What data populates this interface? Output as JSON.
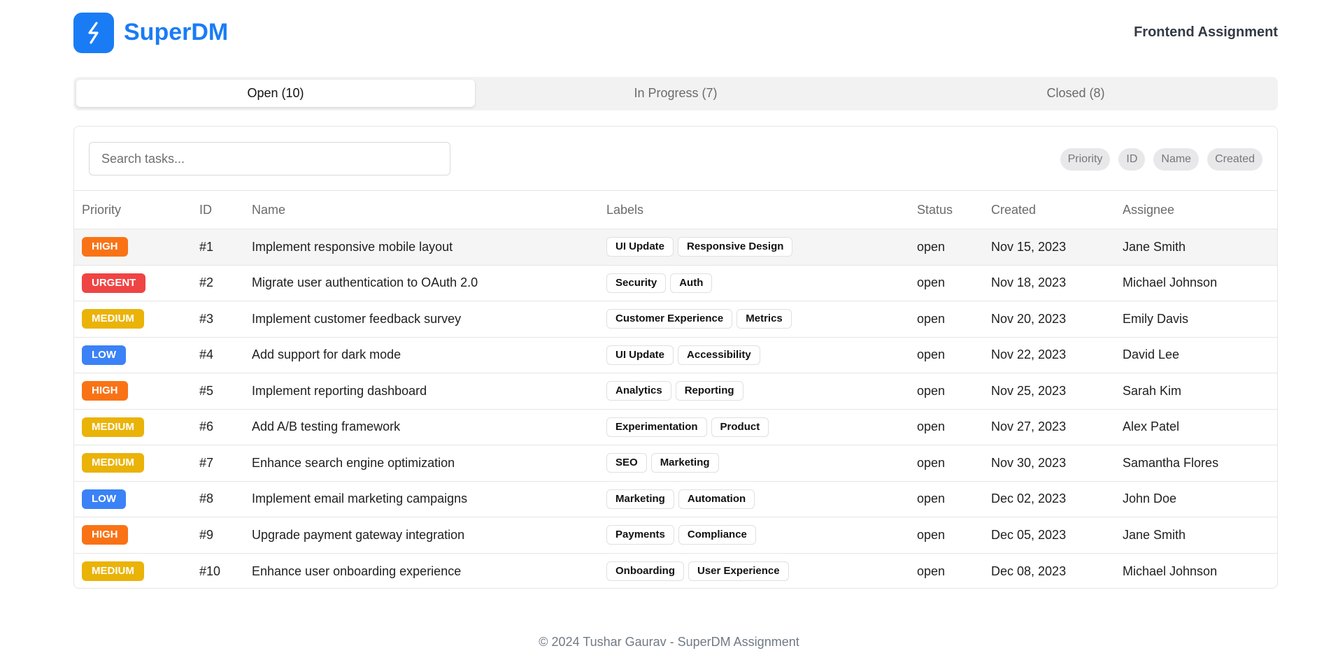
{
  "header": {
    "logo_text": "SuperDM",
    "right_title": "Frontend Assignment",
    "brand_color": "#1a7cf5"
  },
  "tabs": [
    {
      "label": "Open (10)",
      "active": true
    },
    {
      "label": "In Progress (7)",
      "active": false
    },
    {
      "label": "Closed (8)",
      "active": false
    }
  ],
  "search": {
    "placeholder": "Search tasks...",
    "value": ""
  },
  "sort_chips": [
    "Priority",
    "ID",
    "Name",
    "Created"
  ],
  "table": {
    "columns": [
      "Priority",
      "ID",
      "Name",
      "Labels",
      "Status",
      "Created",
      "Assignee"
    ],
    "priority_colors": {
      "HIGH": "#f97316",
      "URGENT": "#ef4444",
      "MEDIUM": "#eab308",
      "LOW": "#3b82f6"
    },
    "rows": [
      {
        "priority": "HIGH",
        "id": "#1",
        "name": "Implement responsive mobile layout",
        "labels": [
          "UI Update",
          "Responsive Design"
        ],
        "status": "open",
        "created": "Nov 15, 2023",
        "assignee": "Jane Smith"
      },
      {
        "priority": "URGENT",
        "id": "#2",
        "name": "Migrate user authentication to OAuth 2.0",
        "labels": [
          "Security",
          "Auth"
        ],
        "status": "open",
        "created": "Nov 18, 2023",
        "assignee": "Michael Johnson"
      },
      {
        "priority": "MEDIUM",
        "id": "#3",
        "name": "Implement customer feedback survey",
        "labels": [
          "Customer Experience",
          "Metrics"
        ],
        "status": "open",
        "created": "Nov 20, 2023",
        "assignee": "Emily Davis"
      },
      {
        "priority": "LOW",
        "id": "#4",
        "name": "Add support for dark mode",
        "labels": [
          "UI Update",
          "Accessibility"
        ],
        "status": "open",
        "created": "Nov 22, 2023",
        "assignee": "David Lee"
      },
      {
        "priority": "HIGH",
        "id": "#5",
        "name": "Implement reporting dashboard",
        "labels": [
          "Analytics",
          "Reporting"
        ],
        "status": "open",
        "created": "Nov 25, 2023",
        "assignee": "Sarah Kim"
      },
      {
        "priority": "MEDIUM",
        "id": "#6",
        "name": "Add A/B testing framework",
        "labels": [
          "Experimentation",
          "Product"
        ],
        "status": "open",
        "created": "Nov 27, 2023",
        "assignee": "Alex Patel"
      },
      {
        "priority": "MEDIUM",
        "id": "#7",
        "name": "Enhance search engine optimization",
        "labels": [
          "SEO",
          "Marketing"
        ],
        "status": "open",
        "created": "Nov 30, 2023",
        "assignee": "Samantha Flores"
      },
      {
        "priority": "LOW",
        "id": "#8",
        "name": "Implement email marketing campaigns",
        "labels": [
          "Marketing",
          "Automation"
        ],
        "status": "open",
        "created": "Dec 02, 2023",
        "assignee": "John Doe"
      },
      {
        "priority": "HIGH",
        "id": "#9",
        "name": "Upgrade payment gateway integration",
        "labels": [
          "Payments",
          "Compliance"
        ],
        "status": "open",
        "created": "Dec 05, 2023",
        "assignee": "Jane Smith"
      },
      {
        "priority": "MEDIUM",
        "id": "#10",
        "name": "Enhance user onboarding experience",
        "labels": [
          "Onboarding",
          "User Experience"
        ],
        "status": "open",
        "created": "Dec 08, 2023",
        "assignee": "Michael Johnson"
      }
    ]
  },
  "footer": {
    "text": "© 2024 Tushar Gaurav - SuperDM Assignment"
  }
}
